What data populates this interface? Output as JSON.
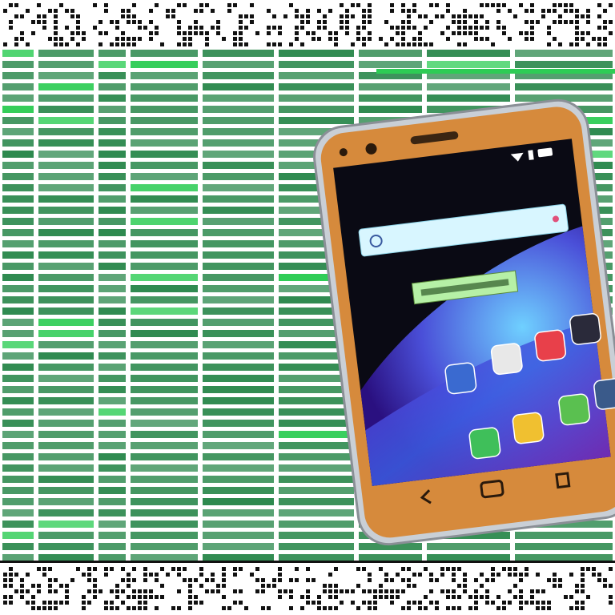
{
  "scene": {
    "top_banner_text": "",
    "bottom_banner_text": "",
    "background_color": "#ffffff",
    "grid_color": "#2e8a4f",
    "grid_highlight_color": "#2ecc55"
  },
  "phone": {
    "body_color": "#d68a3c",
    "frame_color": "#c9cfd6",
    "screen_color": "#0a0a14",
    "status_text": "",
    "search_placeholder": "",
    "banner_label": "",
    "banner_color": "#b6f0a6",
    "apps": [
      {
        "name": "gallery-app-icon",
        "label": ""
      },
      {
        "name": "settings-app-icon",
        "label": ""
      },
      {
        "name": "news-app-icon",
        "label": ""
      },
      {
        "name": "apps-grid-icon",
        "label": ""
      },
      {
        "name": "phone-app-icon",
        "label": ""
      },
      {
        "name": "messages-app-icon",
        "label": ""
      },
      {
        "name": "store-app-icon",
        "label": ""
      },
      {
        "name": "camera-app-icon",
        "label": ""
      }
    ],
    "nav_buttons": [
      "back-button",
      "home-button",
      "recent-apps-button"
    ]
  }
}
